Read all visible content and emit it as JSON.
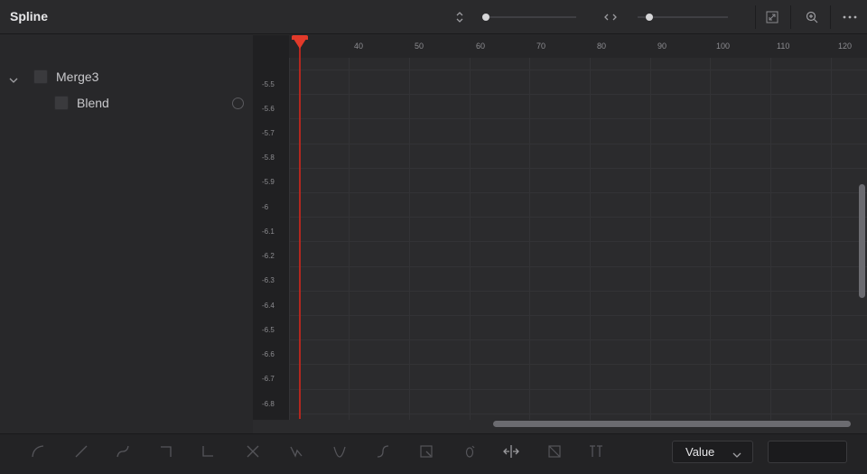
{
  "panel": {
    "title": "Spline"
  },
  "tree": [
    {
      "label": "Merge3"
    },
    {
      "label": "Blend"
    }
  ],
  "graph": {
    "x_ticks": [
      "40",
      "50",
      "60",
      "70",
      "80",
      "90",
      "100",
      "110",
      "120"
    ],
    "y_ticks": [
      "-5.5",
      "-5.6",
      "-5.7",
      "-5.8",
      "-5.9",
      "-6",
      "-6.1",
      "-6.2",
      "-6.3",
      "-6.4",
      "-6.5",
      "-6.6",
      "-6.7",
      "-6.8"
    ]
  },
  "header_icons": [
    "vertical-zoom-icon",
    "horizontal-zoom-icon",
    "zoom-to-fit-icon",
    "zoom-icon",
    "more-options-icon"
  ],
  "toolbar": {
    "tools": [
      "smooth",
      "linear",
      "ease",
      "step-in",
      "step-out",
      "reverse",
      "loop",
      "ping-pong",
      "relative",
      "select-all",
      "set-key",
      "time-stretch",
      "shape-box",
      "text-tool"
    ],
    "mode_select": "Value",
    "value_field": ""
  },
  "colors": {
    "playhead": "#e23a2a",
    "accent_text": "#e6e6e8"
  }
}
